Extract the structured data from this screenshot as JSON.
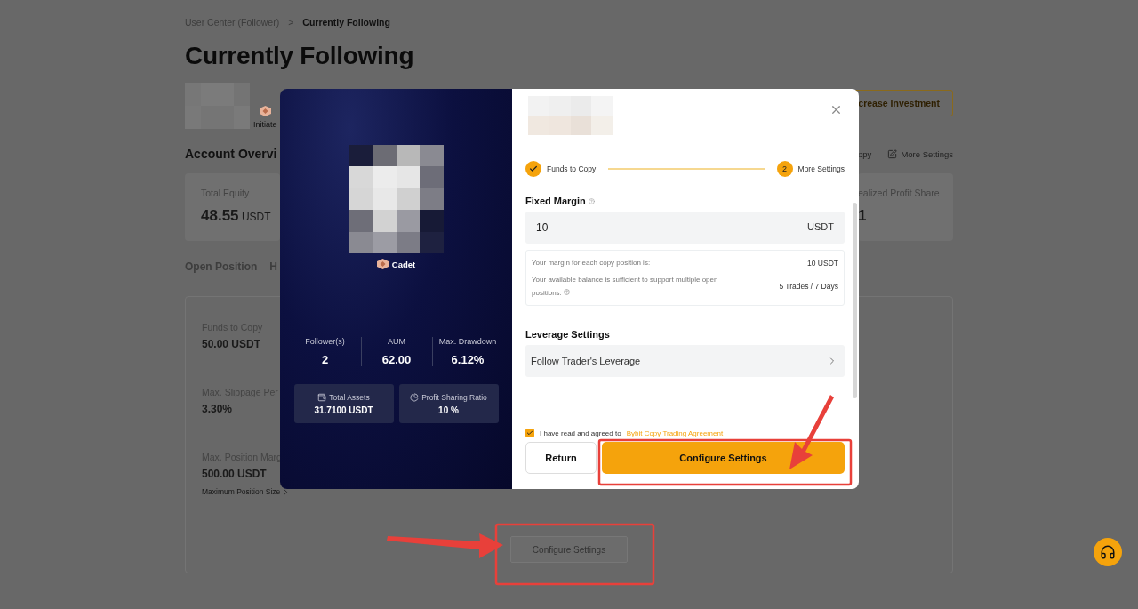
{
  "breadcrumb": {
    "items": [
      "User Center (Follower)",
      "Currently Following"
    ],
    "separator": ">"
  },
  "title": "Currently Following",
  "trader": {
    "badge_label": "Initiate"
  },
  "increase_button": "crease Investment",
  "overview": {
    "heading": "Account Overvi",
    "links": [
      {
        "kind": "plain",
        "label": "opy"
      },
      {
        "kind": "edit",
        "label": "More Settings"
      }
    ]
  },
  "stats": [
    {
      "label": "Total Equity",
      "value": "48.55",
      "unit": "USDT"
    },
    {
      "label": "ealized Profit Share",
      "value": "1"
    }
  ],
  "tabs": [
    "Open Position",
    "H"
  ],
  "settings": {
    "items": [
      {
        "label": "Funds to Copy",
        "value": "50.00 USDT"
      },
      {
        "label": "Max. Slippage Per",
        "value": "3.30%"
      },
      {
        "label": "Max. Position Marg",
        "value": "500.00 USDT",
        "link": "Maximum Position Size"
      }
    ],
    "button": "Configure Settings"
  },
  "modal": {
    "trader": {
      "rank": "Cadet",
      "metrics": [
        {
          "label": "Follower(s)",
          "value": "2"
        },
        {
          "label": "AUM",
          "value": "62.00"
        },
        {
          "label": "Max. Drawdown",
          "value": "6.12%"
        }
      ],
      "boxes": [
        {
          "kind": "wallet",
          "label": "Total Assets",
          "value": "31.7100 USDT"
        },
        {
          "kind": "pie",
          "label": "Profit Sharing Ratio",
          "value": "10 %"
        }
      ]
    },
    "steps": [
      {
        "label": "Funds to Copy",
        "done": true
      },
      {
        "label": "More Settings",
        "done": false,
        "number": "2"
      }
    ],
    "fixed_margin": {
      "label": "Fixed Margin",
      "value": "10",
      "unit": "USDT"
    },
    "info": [
      {
        "text": "Your margin for each copy position is:",
        "value": "10 USDT"
      },
      {
        "text": "Your available balance is sufficient to support multiple open positions.",
        "value": "5 Trades / 7 Days",
        "hint": true
      }
    ],
    "leverage": {
      "label": "Leverage Settings",
      "value": "Follow Trader's Leverage"
    },
    "agreement": {
      "checked": true,
      "text": "I have read and agreed to",
      "link": "Bybit Copy Trading Agreement"
    },
    "return_button": "Return",
    "confirm_button": "Configure Settings"
  }
}
